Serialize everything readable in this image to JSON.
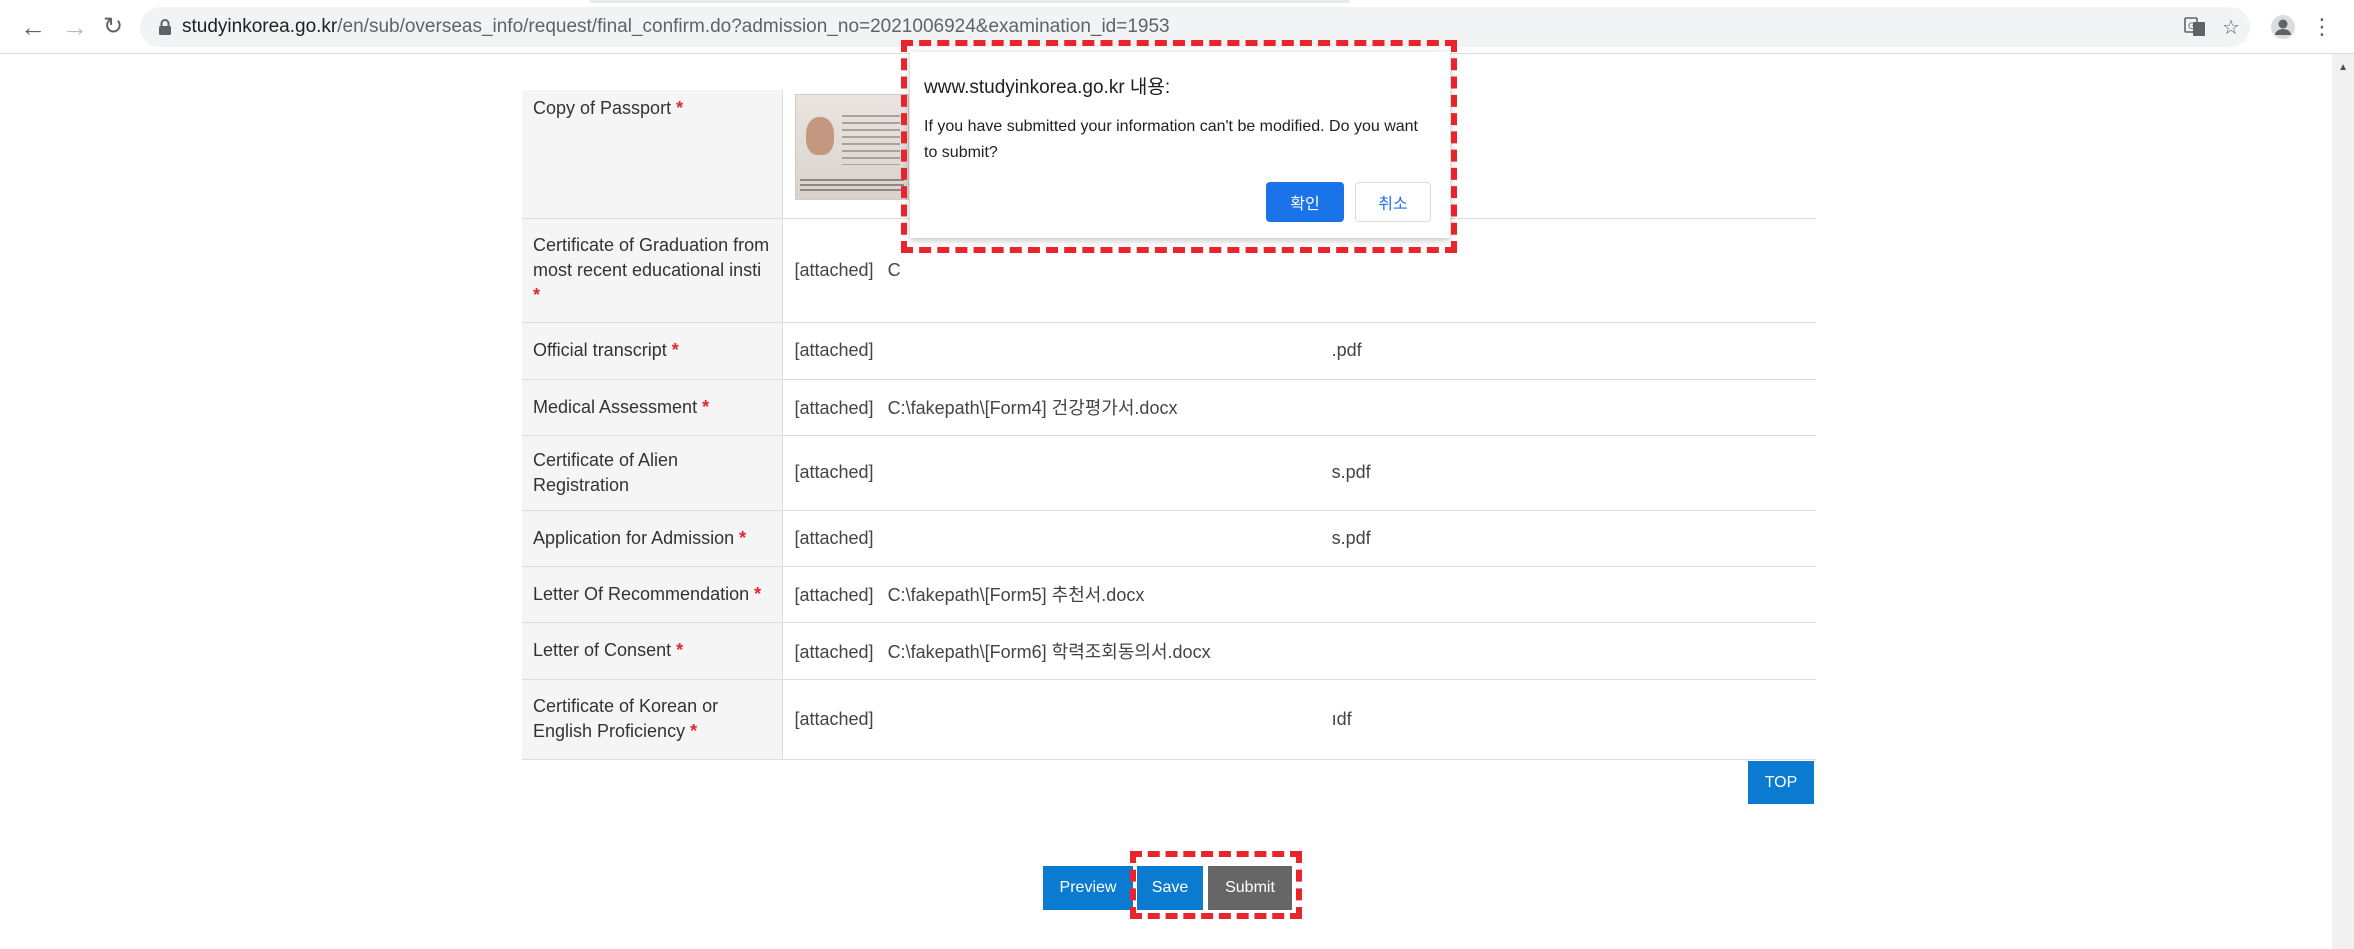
{
  "browser": {
    "url_host": "studyinkorea.go.kr",
    "url_path": "/en/sub/overseas_info/request/final_confirm.do?admission_no=2021006924&examination_id=1953",
    "icons": [
      "back-icon",
      "forward-icon",
      "reload-icon",
      "lock-icon",
      "translate-icon",
      "star-icon",
      "profile-icon",
      "menu-icon"
    ]
  },
  "documents": [
    {
      "label": "Copy of Passport",
      "required": true,
      "type": "image"
    },
    {
      "label": "Certificate of Graduation from most recent educational insti",
      "required": true,
      "attached": "[attached]",
      "file": "C"
    },
    {
      "label": "Official transcript",
      "required": true,
      "attached": "[attached]",
      "file": ".pdf"
    },
    {
      "label": "Medical Assessment",
      "required": true,
      "attached": "[attached]",
      "file": "C:\\fakepath\\[Form4] 건강평가서.docx"
    },
    {
      "label": "Certificate of Alien Registration",
      "required": false,
      "attached": "[attached]",
      "file": "s.pdf"
    },
    {
      "label": "Application for Admission",
      "required": true,
      "attached": "[attached]",
      "file": "s.pdf"
    },
    {
      "label": "Letter Of Recommendation",
      "required": true,
      "attached": "[attached]",
      "file": "C:\\fakepath\\[Form5] 추천서.docx"
    },
    {
      "label": "Letter of Consent",
      "required": true,
      "attached": "[attached]",
      "file": "C:\\fakepath\\[Form6] 학력조회동의서.docx"
    },
    {
      "label": "Certificate of Korean or English Proficiency",
      "required": true,
      "attached": "[attached]",
      "file": "ıdf"
    }
  ],
  "required_mark": "*",
  "buttons": {
    "top": "TOP",
    "preview": "Preview",
    "save": "Save",
    "submit": "Submit"
  },
  "dialog": {
    "title": "www.studyinkorea.go.kr 내용:",
    "message": "If you have submitted your information can't be modified. Do you want to submit?",
    "ok": "확인",
    "cancel": "취소"
  },
  "colors": {
    "primary_button": "#0a7bd1",
    "submit_button": "#666666",
    "required_mark": "#e8242d",
    "highlight_dash": "#e8242d",
    "dialog_ok": "#1a73e8"
  }
}
